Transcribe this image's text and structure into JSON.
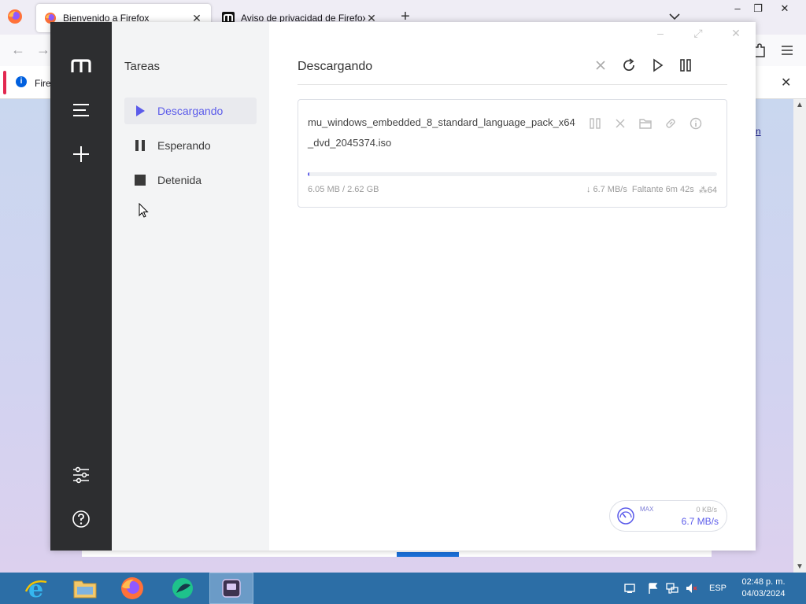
{
  "firefox": {
    "tabs": [
      {
        "title": "Bienvenido a Firefox",
        "active": true
      },
      {
        "title": "Aviso de privacidad de Firefox",
        "active": false
      }
    ],
    "notice_text": "Fire",
    "page_link_fragment": "n"
  },
  "motrix": {
    "sidebar": {
      "title": "Tareas",
      "items": [
        {
          "label": "Descargando",
          "icon": "play-icon",
          "active": true
        },
        {
          "label": "Esperando",
          "icon": "pause-icon",
          "active": false
        },
        {
          "label": "Detenida",
          "icon": "stop-icon",
          "active": false
        }
      ]
    },
    "header": {
      "title": "Descargando"
    },
    "task": {
      "name": "mu_windows_embedded_8_standard_language_pack_x64_dvd_2045374.iso",
      "size": "6.05 MB / 2.62 GB",
      "speed": "↓ 6.7 MB/s",
      "remaining": "Faltante 6m 42s",
      "connections": "64",
      "progress": 0.0023
    },
    "speedometer": {
      "max_label": "MAX",
      "upload": "0 KB/s",
      "download": "6.7 MB/s"
    }
  },
  "taskbar": {
    "lang": "ESP",
    "time": "02:48 p. m.",
    "date": "04/03/2024"
  },
  "colors": {
    "accent": "#5b5bea",
    "rail": "#2d2e30",
    "taskbar": "#2c6ea6"
  }
}
